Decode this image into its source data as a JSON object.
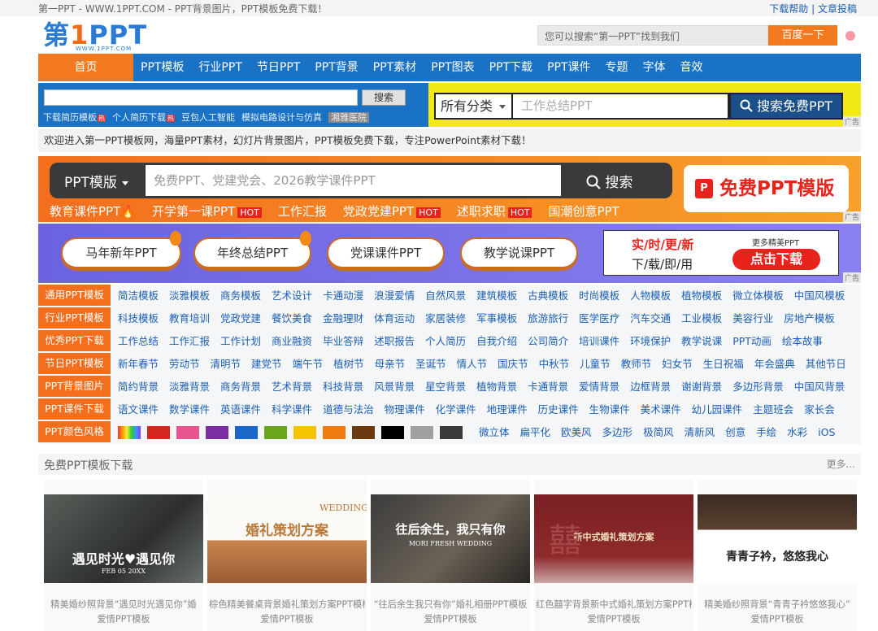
{
  "topbar": {
    "site_line": "第一PPT - WWW.1PPT.COM - PPT背景图片，PPT模板免费下载！",
    "help": "下载帮助",
    "sep": "|",
    "submit": "文章投稿"
  },
  "header": {
    "logo_main_a": "第",
    "logo_main_b": "1",
    "logo_main_c": "PPT",
    "logo_sub": "WWW.1PPT.COM",
    "search_placeholder": "您可以搜索“第一PPT”找到我们",
    "search_button": "百度一下"
  },
  "nav": {
    "home": "首页",
    "items": [
      "PPT模板",
      "行业PPT",
      "节日PPT",
      "PPT背景",
      "PPT素材",
      "PPT图表",
      "PPT下载",
      "PPT课件",
      "专题",
      "字体",
      "音效"
    ]
  },
  "search_left": {
    "button": "搜索",
    "links": [
      "下载简历模板",
      "个人简历下载",
      "豆包人工智能",
      "模拟电路设计与仿真",
      "湘雅医院"
    ],
    "hot_mark": "热"
  },
  "search_right": {
    "category": "所有分类",
    "placeholder": "工作总结PPT",
    "button": "搜索免费PPT",
    "ad": "广告"
  },
  "welcome": "欢迎进入第一PPT模板网，海量PPT素材，幻灯片背景图片，PPT模板免费下载，专注PowerPoint素材下载！",
  "orange_banner": {
    "type": "PPT模版",
    "placeholder": "免费PPT、党建党会、2026教学课件PPT",
    "search": "搜索",
    "free_button": "免费PPT模版",
    "pi": "P",
    "tags": [
      {
        "label": "教育课件PPT🔥",
        "hot": ""
      },
      {
        "label": "开学第一课PPT",
        "hot": "HOT"
      },
      {
        "label": "工作汇报",
        "hot": ""
      },
      {
        "label": "党政党建PPT",
        "hot": "HOT"
      },
      {
        "label": "述职求职",
        "hot": "HOT"
      },
      {
        "label": "国潮创意PPT",
        "hot": ""
      }
    ],
    "ad": "广告"
  },
  "purple_banner": {
    "buttons": [
      "马年新年PPT",
      "年终总结PPT",
      "党课课件PPT",
      "教学说课PPT"
    ],
    "realtime": "实/时/更/新",
    "download_use": "下/载/即/用",
    "more": "更多精美PPT",
    "click": "点击下载",
    "ad": "广告"
  },
  "categories": [
    {
      "label": "通用PPT模板",
      "items": [
        "简洁模板",
        "淡雅模板",
        "商务模板",
        "艺术设计",
        "卡通动漫",
        "浪漫爱情",
        "自然风景",
        "建筑模板",
        "古典模板",
        "时尚模板",
        "人物模板",
        "植物模板",
        "微立体模板",
        "中国风模板"
      ]
    },
    {
      "label": "行业PPT模板",
      "items": [
        "科技模板",
        "教育培训",
        "党政党建",
        "餐饮美食",
        "金融理财",
        "体育运动",
        "家居装修",
        "军事模板",
        "旅游旅行",
        "医学医疗",
        "汽车交通",
        "工业模板",
        "美容行业",
        "房地产模板"
      ]
    },
    {
      "label": "优秀PPT下载",
      "items": [
        "工作总结",
        "工作汇报",
        "工作计划",
        "商业融资",
        "毕业答辩",
        "述职报告",
        "个人简历",
        "自我介绍",
        "公司简介",
        "培训课件",
        "环境保护",
        "教学说课",
        "PPT动画",
        "绘本故事"
      ]
    },
    {
      "label": "节日PPT模板",
      "items": [
        "新年春节",
        "劳动节",
        "清明节",
        "建党节",
        "端午节",
        "植树节",
        "母亲节",
        "圣诞节",
        "情人节",
        "国庆节",
        "中秋节",
        "儿童节",
        "教师节",
        "妇女节",
        "生日祝福",
        "年会盛典",
        "其他节日"
      ]
    },
    {
      "label": "PPT背景图片",
      "items": [
        "简约背景",
        "淡雅背景",
        "商务背景",
        "艺术背景",
        "科技背景",
        "风景背景",
        "星空背景",
        "植物背景",
        "卡通背景",
        "爱情背景",
        "边框背景",
        "谢谢背景",
        "多边形背景",
        "中国风背景"
      ]
    },
    {
      "label": "PPT课件下载",
      "items": [
        "语文课件",
        "数学课件",
        "英语课件",
        "科学课件",
        "道德与法治",
        "物理课件",
        "化学课件",
        "地理课件",
        "历史课件",
        "生物课件",
        "美术课件",
        "幼儿园课件",
        "主题班会",
        "家长会"
      ]
    },
    {
      "label": "PPT颜色风格",
      "items": [
        "微立体",
        "扁平化",
        "欧美风",
        "多边形",
        "极简风",
        "清新风",
        "创意",
        "手绘",
        "水彩",
        "iOS"
      ]
    }
  ],
  "colors": {
    "orange": "#f36e1d",
    "blue": "#1a72c4",
    "yellow": "#f2ea17",
    "swatches": [
      "#d4261c",
      "#e8558e",
      "#7b2fa3",
      "#1a66c9",
      "#6aa51c",
      "#f5c400",
      "#f07b10",
      "#6b3a10",
      "#000000",
      "#a0a0a0",
      "#3a3a3a"
    ]
  },
  "section": {
    "title": "免费PPT模板下载",
    "more": "更多..."
  },
  "cards": [
    {
      "title": "遇见时光♥遇见你",
      "subtitle": "FEB 05 20XX",
      "cap1": "精美婚纱照背景“遇见时光遇见你”婚",
      "cap2": "爱情PPT模板"
    },
    {
      "title": "婚礼策划方案",
      "subtitle": "WEDDING",
      "cap1": "棕色精美餐桌背景婚礼策划方案PPT模板",
      "cap2": "爱情PPT模板"
    },
    {
      "title": "往后余生，我只有你",
      "subtitle": "MORI FRESH WEDDING",
      "cap1": "“往后余生我只有你”婚礼相册PPT模板",
      "cap2": "爱情PPT模板"
    },
    {
      "title": "新中式婚礼策划方案",
      "subtitle": "囍",
      "cap1": "红色囍字背景新中式婚礼策划方案PPT模",
      "cap2": "爱情PPT模板"
    },
    {
      "title": "青青子衿，悠悠我心",
      "subtitle": "",
      "cap1": "精美婚纱照背景“青青子衿悠悠我心”",
      "cap2": "爱情PPT模板"
    }
  ]
}
